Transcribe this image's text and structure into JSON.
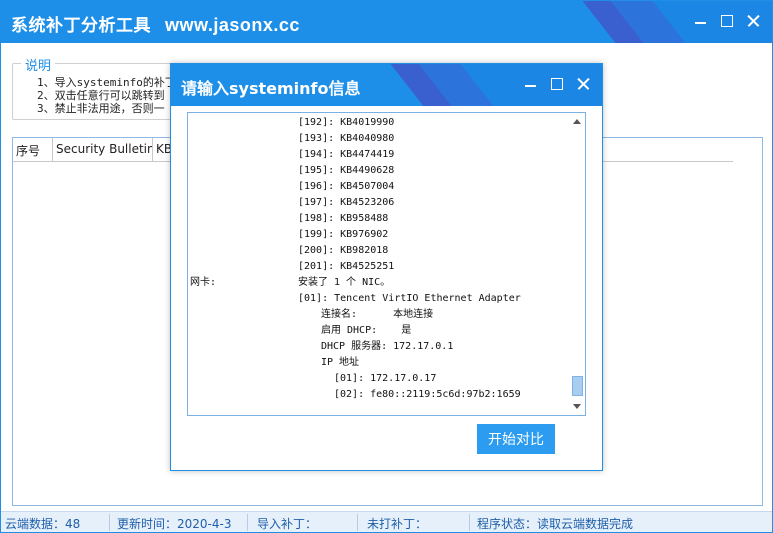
{
  "main": {
    "title": "系统补丁分析工具",
    "site": "www.jasonx.cc",
    "description": {
      "legend": "说明",
      "lines": [
        "1、导入systeminfo的补丁",
        "2、双击任意行可以跳转到",
        "3、禁止非法用途，否则一"
      ]
    },
    "table": {
      "headers": [
        "序号",
        "Security Bulletin",
        "KB"
      ]
    }
  },
  "status": {
    "cloud": "云端数据：48",
    "update": "更新时间：2020-4-3",
    "imported": "导入补丁：",
    "missing": "未打补丁：",
    "state": "程序状态：读取云端数据完成"
  },
  "dialog": {
    "title": "请输入systeminfo信息",
    "button": "开始对比",
    "lines": [
      {
        "key": "",
        "value": "[192]: KB4019990",
        "indent": 110
      },
      {
        "key": "",
        "value": "[193]: KB4040980",
        "indent": 110
      },
      {
        "key": "",
        "value": "[194]: KB4474419",
        "indent": 110
      },
      {
        "key": "",
        "value": "[195]: KB4490628",
        "indent": 110
      },
      {
        "key": "",
        "value": "[196]: KB4507004",
        "indent": 110
      },
      {
        "key": "",
        "value": "[197]: KB4523206",
        "indent": 110
      },
      {
        "key": "",
        "value": "[198]: KB958488",
        "indent": 110
      },
      {
        "key": "",
        "value": "[199]: KB976902",
        "indent": 110
      },
      {
        "key": "",
        "value": "[200]: KB982018",
        "indent": 110
      },
      {
        "key": "",
        "value": "[201]: KB4525251",
        "indent": 110
      },
      {
        "key": "网卡:",
        "value": "安装了 1 个 NIC。",
        "indent": 110
      },
      {
        "key": "",
        "value": "[01]: Tencent VirtIO Ethernet Adapter",
        "indent": 110
      },
      {
        "key": "",
        "value": "连接名:      本地连接",
        "indent": 133
      },
      {
        "key": "",
        "value": "启用 DHCP:    是",
        "indent": 133
      },
      {
        "key": "",
        "value": "DHCP 服务器: 172.17.0.1",
        "indent": 133
      },
      {
        "key": "",
        "value": "IP 地址",
        "indent": 133
      },
      {
        "key": "",
        "value": "[01]: 172.17.0.17",
        "indent": 146
      },
      {
        "key": "",
        "value": "[02]: fe80::2119:5c6d:97b2:1659",
        "indent": 146
      }
    ]
  }
}
